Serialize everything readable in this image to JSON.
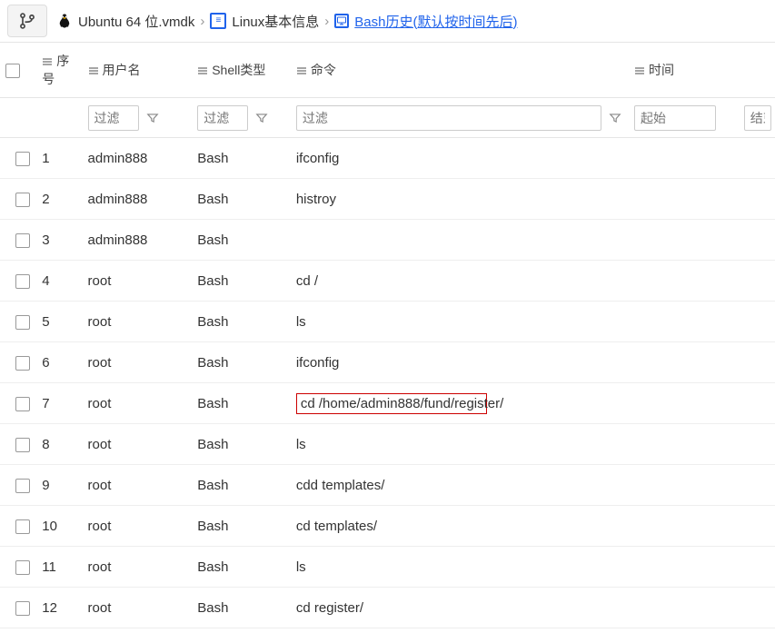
{
  "breadcrumb": {
    "item1": "Ubuntu 64 位.vmdk",
    "item2": "Linux基本信息",
    "item3": "Bash历史(默认按时间先后)",
    "sep": "›"
  },
  "headers": {
    "seq": "序号",
    "user": "用户名",
    "shell": "Shell类型",
    "cmd": "命令",
    "time": "时间"
  },
  "filters": {
    "placeholder_filter": "过滤",
    "placeholder_start": "起始",
    "placeholder_end": "结束"
  },
  "rows": [
    {
      "seq": "1",
      "user": "admin888",
      "shell": "Bash",
      "cmd": "ifconfig"
    },
    {
      "seq": "2",
      "user": "admin888",
      "shell": "Bash",
      "cmd": "histroy"
    },
    {
      "seq": "3",
      "user": "admin888",
      "shell": "Bash",
      "cmd": ""
    },
    {
      "seq": "4",
      "user": "root",
      "shell": "Bash",
      "cmd": "cd /"
    },
    {
      "seq": "5",
      "user": "root",
      "shell": "Bash",
      "cmd": "ls"
    },
    {
      "seq": "6",
      "user": "root",
      "shell": "Bash",
      "cmd": "ifconfig"
    },
    {
      "seq": "7",
      "user": "root",
      "shell": "Bash",
      "cmd": "cd /home/admin888/fund/register/",
      "highlight": true
    },
    {
      "seq": "8",
      "user": "root",
      "shell": "Bash",
      "cmd": "ls"
    },
    {
      "seq": "9",
      "user": "root",
      "shell": "Bash",
      "cmd": "cdd templates/"
    },
    {
      "seq": "10",
      "user": "root",
      "shell": "Bash",
      "cmd": "cd templates/"
    },
    {
      "seq": "11",
      "user": "root",
      "shell": "Bash",
      "cmd": "ls"
    },
    {
      "seq": "12",
      "user": "root",
      "shell": "Bash",
      "cmd": "cd register/"
    }
  ]
}
